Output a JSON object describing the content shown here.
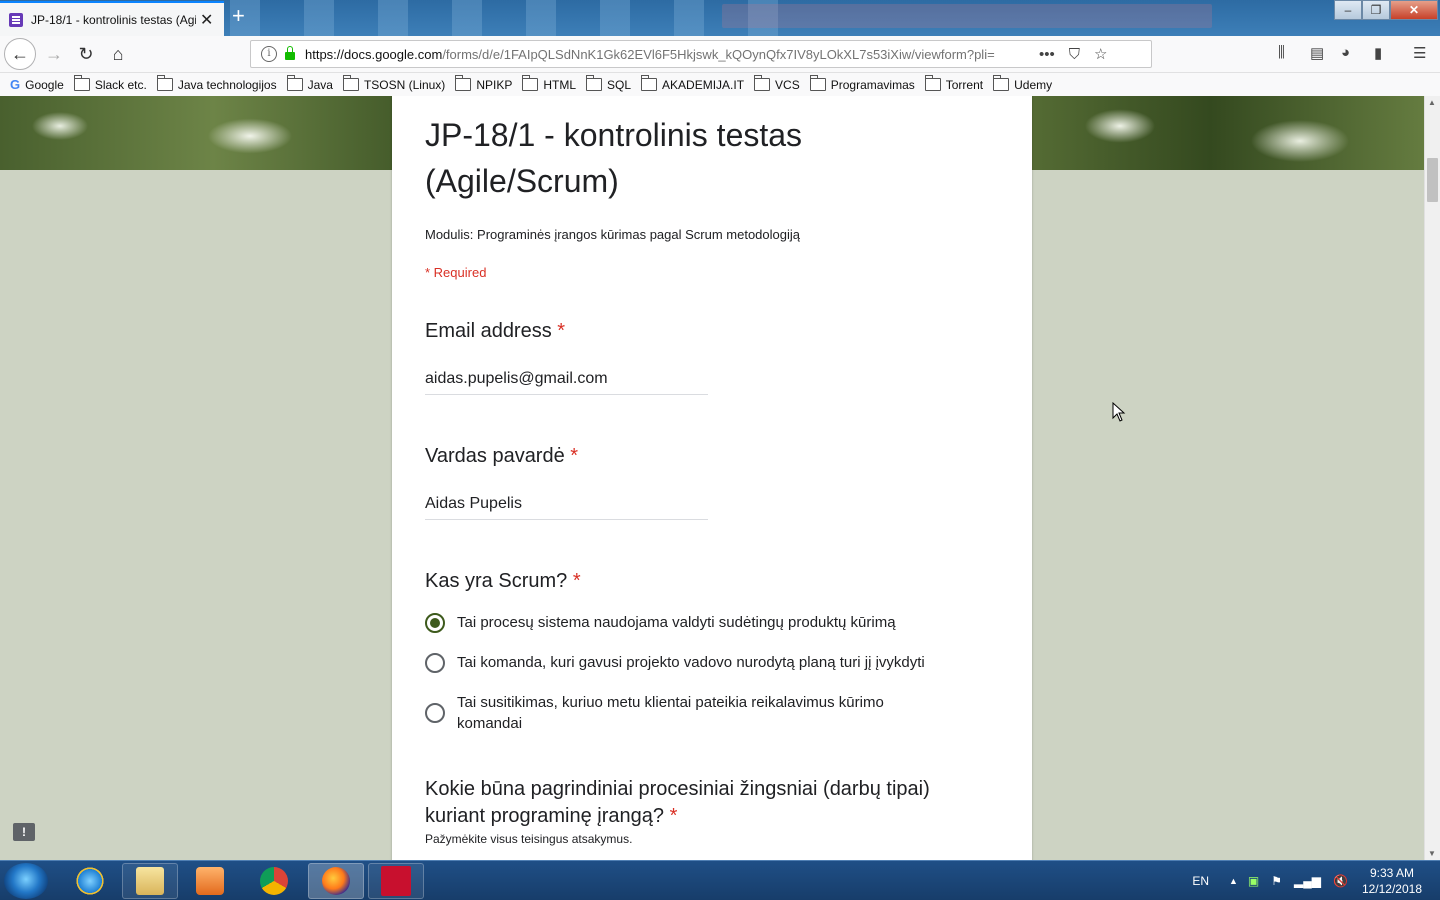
{
  "browser": {
    "tab_title": "JP-18/1 - kontrolinis testas (Agi",
    "tab_close": "✕",
    "new_tab": "+",
    "url_host": "https://docs.google.com",
    "url_rest": "/forms/d/e/1FAIpQLSdNnK1Gk62EVl6F5Hkjswk_kQOynQfx7IV8yLOkXL7s53iXiw/viewform?pli=",
    "window_controls": {
      "minimize": "‒",
      "restore": "❐",
      "close": "✕"
    }
  },
  "bookmarks": [
    {
      "label": "Google",
      "icon": "google-icon"
    },
    {
      "label": "Slack etc.",
      "icon": "folder-icon"
    },
    {
      "label": "Java technologijos",
      "icon": "folder-icon"
    },
    {
      "label": "Java",
      "icon": "folder-icon"
    },
    {
      "label": "TSOSN (Linux)",
      "icon": "folder-icon"
    },
    {
      "label": "NPIKP",
      "icon": "folder-icon"
    },
    {
      "label": "HTML",
      "icon": "folder-icon"
    },
    {
      "label": "SQL",
      "icon": "folder-icon"
    },
    {
      "label": "AKADEMIJA.IT",
      "icon": "folder-icon"
    },
    {
      "label": "VCS",
      "icon": "folder-icon"
    },
    {
      "label": "Programavimas",
      "icon": "folder-icon"
    },
    {
      "label": "Torrent",
      "icon": "folder-icon"
    },
    {
      "label": "Udemy",
      "icon": "folder-icon"
    }
  ],
  "form": {
    "title": "JP-18/1 - kontrolinis testas (Agile/Scrum)",
    "description": "Modulis: Programinės įrangos kūrimas pagal Scrum metodologiją",
    "required_note": "* Required",
    "required_star": "*",
    "questions": [
      {
        "title": "Email address",
        "answer": "aidas.pupelis@gmail.com"
      },
      {
        "title": "Vardas pavardė",
        "answer": "Aidas Pupelis"
      },
      {
        "title": "Kas yra Scrum?",
        "options": [
          {
            "label": "Tai procesų sistema naudojama valdyti sudėtingų produktų kūrimą",
            "selected": true
          },
          {
            "label": "Tai komanda, kuri gavusi projekto vadovo nurodytą planą turi jį įvykdyti",
            "selected": false
          },
          {
            "label": "Tai susitikimas, kuriuo metu klientai pateikia reikalavimus kūrimo komandai",
            "selected": false
          }
        ]
      },
      {
        "title": "Kokie būna pagrindiniai procesiniai žingsniai (darbų tipai) kuriant programinę įrangą?",
        "hint": "Pažymėkite visus teisingus atsakymus."
      }
    ]
  },
  "taskbar": {
    "language": "EN",
    "time": "9:33 AM",
    "date": "12/12/2018"
  },
  "colors": {
    "accent": "#3d5a1c",
    "required": "#d93025",
    "page_bg": "#cdd3c3"
  }
}
